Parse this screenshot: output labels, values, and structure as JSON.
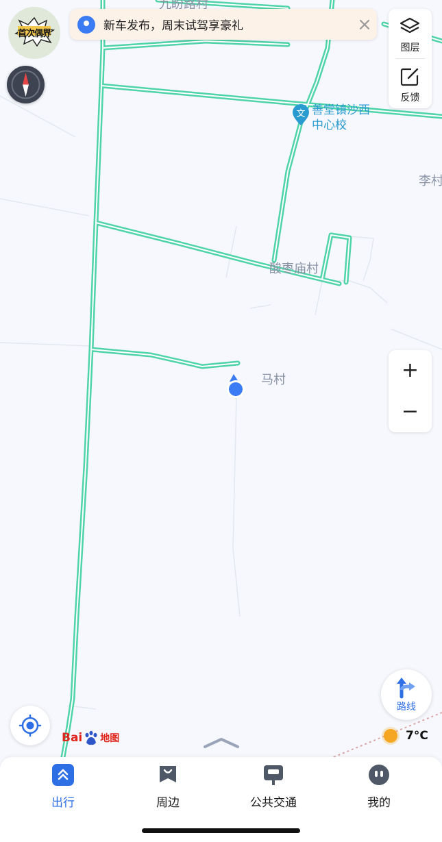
{
  "banner": {
    "text": "新车发布，周末试驾享豪礼",
    "close": "×"
  },
  "badge": {
    "text": "首次偶界"
  },
  "layers": {
    "layer_label": "图层",
    "feedback_label": "反馈"
  },
  "zoom": {
    "in": "+",
    "out": "−"
  },
  "map_labels": {
    "top_village": "九盼路村",
    "li_village": "李村",
    "suanzaomiao": "酸枣庙村",
    "ma_village": "马村",
    "poi_school": "善堂镇沙西\n中心校",
    "poi_icon_char": "文"
  },
  "route": {
    "label": "路线"
  },
  "logo": {
    "bai": "Bai",
    "map": "地图"
  },
  "weather": {
    "temp": "7°C"
  },
  "tabs": [
    {
      "label": "出行"
    },
    {
      "label": "周边"
    },
    {
      "label": "公共交通"
    },
    {
      "label": "我的"
    }
  ],
  "colors": {
    "road": "#4fd3a8",
    "accent": "#2e6fe6",
    "location": "#3b7cf5",
    "poi": "#2a9bd1"
  }
}
